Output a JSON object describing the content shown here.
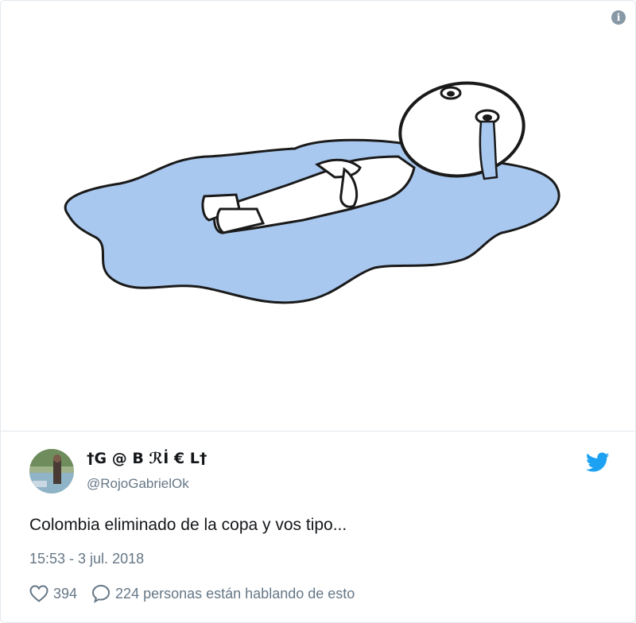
{
  "media": {
    "info_icon_glyph": "i",
    "colors": {
      "puddle": "#a9c8ef",
      "outline": "#1a1a1a",
      "figure": "#ffffff"
    }
  },
  "tweet": {
    "author": {
      "display_name": "†G @ B ℛİ € L†",
      "handle": "@RojoGabrielOk"
    },
    "text": "Colombia eliminado de la copa y vos tipo...",
    "timestamp": "15:53 - 3 jul. 2018",
    "likes": "394",
    "replies_label": "224 personas están hablando de esto",
    "colors": {
      "brand": "#1da1f2",
      "muted": "#657786",
      "text": "#14171a"
    }
  },
  "icons": {
    "info": "info-icon",
    "twitter": "twitter-bird-icon",
    "like": "heart-icon",
    "reply": "speech-bubble-icon"
  }
}
